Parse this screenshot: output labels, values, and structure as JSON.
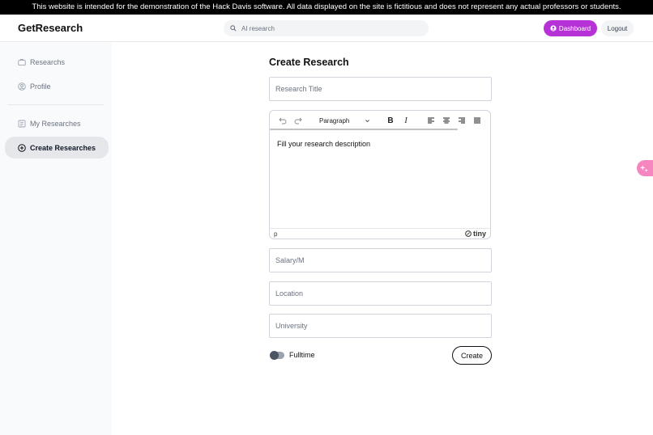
{
  "banner": {
    "text": "This website is intended for the demonstration of the Hack Davis software. All data displayed on the site is fictitious and does not represent any actual professors or students."
  },
  "header": {
    "logo": "GetResearch",
    "search_placeholder": "AI research",
    "dashboard_label": "Dashboard",
    "logout_label": "Logout",
    "accent_color": "#b632d6"
  },
  "sidebar": {
    "items": [
      {
        "label": "Researchs",
        "icon": "briefcase-icon",
        "active": false
      },
      {
        "label": "Profile",
        "icon": "user-circle-icon",
        "active": false
      },
      {
        "label": "My Researches",
        "icon": "document-list-icon",
        "active": false
      },
      {
        "label": "Create Researches",
        "icon": "plus-circle-icon",
        "active": true
      }
    ]
  },
  "form": {
    "title": "Create Research",
    "title_placeholder": "Research Title",
    "editor": {
      "format_label": "Paragraph",
      "body_text": "Fill your research description",
      "status_element": "p",
      "brand": "tiny"
    },
    "salary_placeholder": "Salary/M",
    "location_placeholder": "Location",
    "university_placeholder": "University",
    "fulltime_label": "Fulltime",
    "fulltime_on": false,
    "create_label": "Create"
  }
}
